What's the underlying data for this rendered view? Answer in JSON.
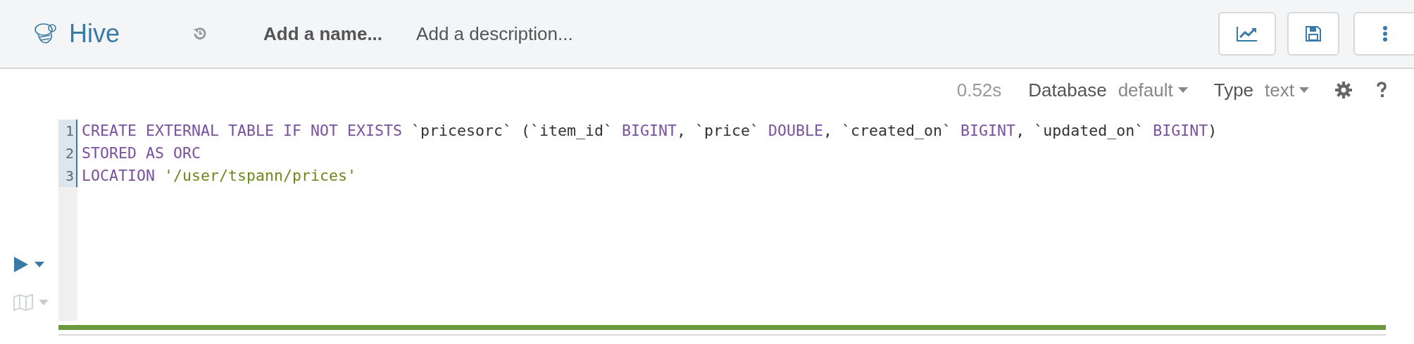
{
  "header": {
    "app_name": "Hive",
    "name_placeholder": "Add a name...",
    "description_placeholder": "Add a description..."
  },
  "toolbar": {
    "duration": "0.52s",
    "database_label": "Database",
    "database_value": "default",
    "type_label": "Type",
    "type_value": "text"
  },
  "editor": {
    "lines": [
      {
        "number": "1",
        "tokens": [
          {
            "kind": "keyword",
            "text": "CREATE EXTERNAL TABLE IF NOT EXISTS"
          },
          {
            "kind": "plain",
            "text": " `pricesorc` (`item_id` "
          },
          {
            "kind": "keyword",
            "text": "BIGINT"
          },
          {
            "kind": "plain",
            "text": ", `price` "
          },
          {
            "kind": "keyword",
            "text": "DOUBLE"
          },
          {
            "kind": "plain",
            "text": ", `created_on` "
          },
          {
            "kind": "keyword",
            "text": "BIGINT"
          },
          {
            "kind": "plain",
            "text": ", `updated_on` "
          },
          {
            "kind": "keyword",
            "text": "BIGINT"
          },
          {
            "kind": "plain",
            "text": ")"
          }
        ]
      },
      {
        "number": "2",
        "tokens": [
          {
            "kind": "keyword",
            "text": "STORED AS ORC"
          }
        ]
      },
      {
        "number": "3",
        "tokens": [
          {
            "kind": "keyword",
            "text": "LOCATION "
          },
          {
            "kind": "string",
            "text": "'/user/tspann/prices'"
          }
        ]
      }
    ]
  },
  "progress": {
    "level": 1
  }
}
